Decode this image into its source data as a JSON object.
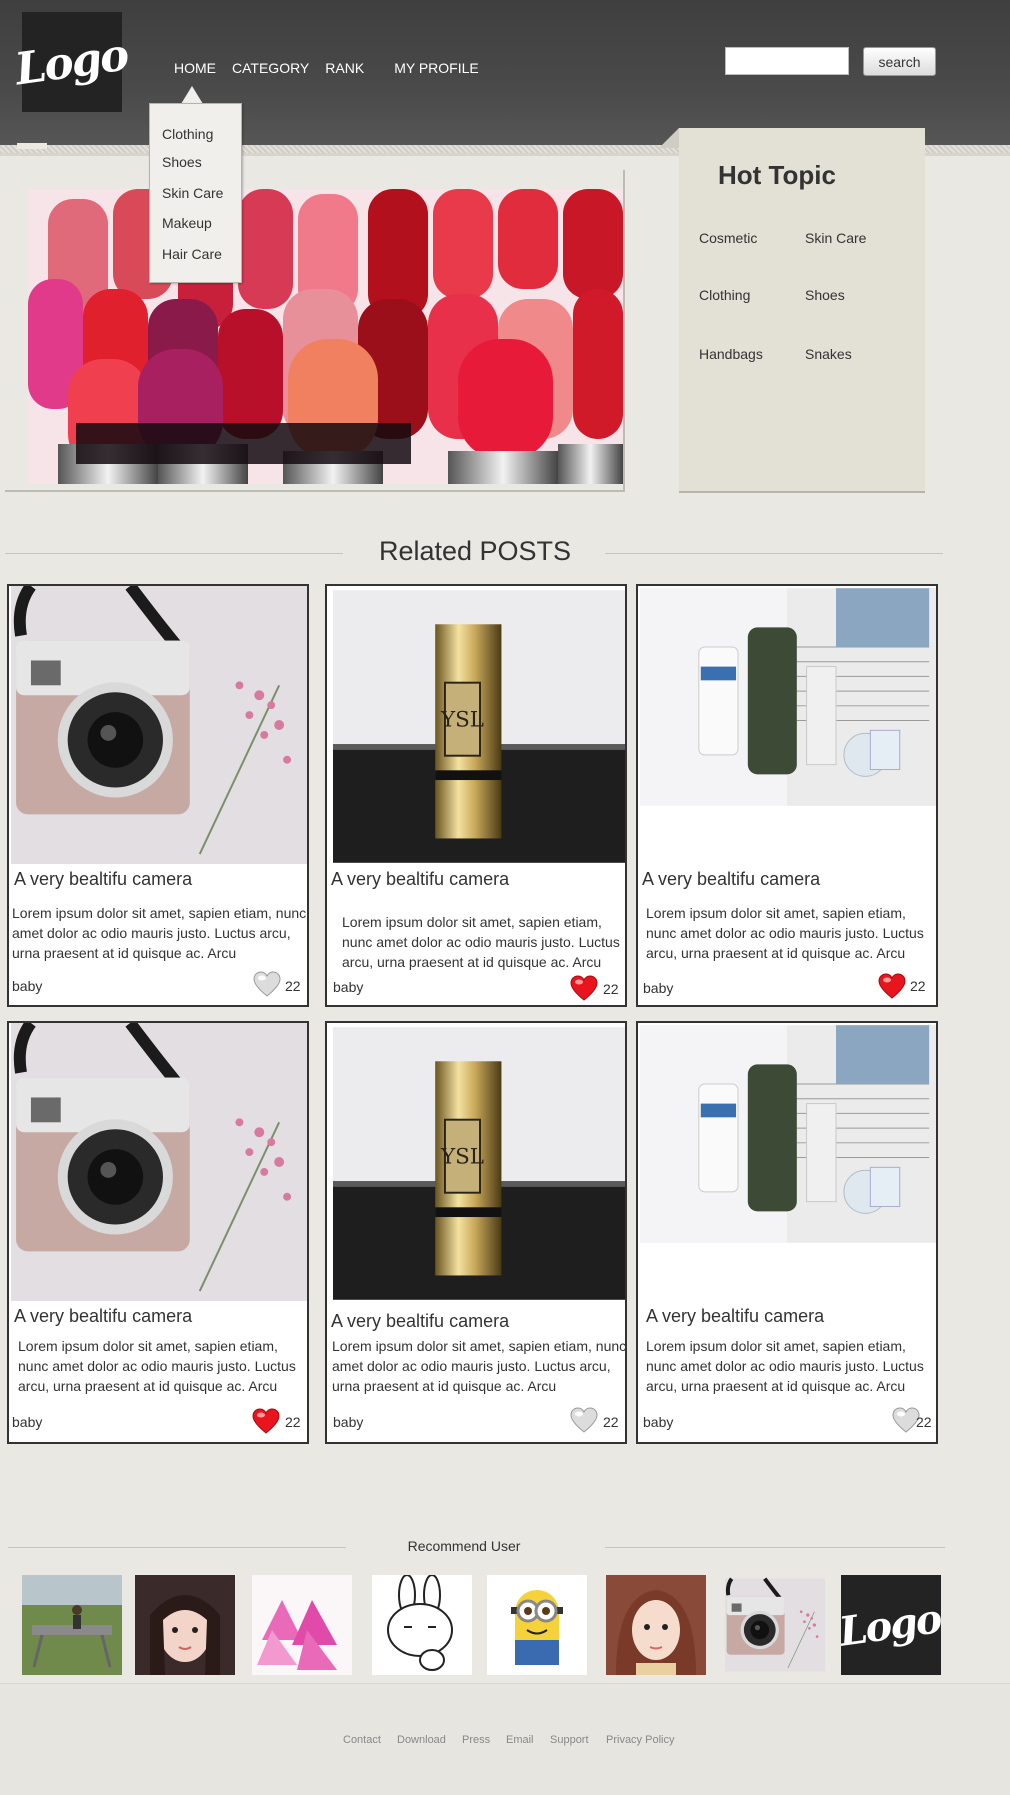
{
  "header": {
    "logo_text": "Logo",
    "nav": [
      "HOME",
      "CATEGORY",
      "RANK",
      "MY PROFILE"
    ],
    "search": {
      "value": "",
      "button_label": "search"
    }
  },
  "dropdown": {
    "items": [
      "Clothing",
      "Shoes",
      "Skin Care",
      "Makeup",
      "Hair Care"
    ]
  },
  "hot_topic": {
    "title": "Hot Topic",
    "items": [
      "Cosmetic",
      "Skin Care",
      "Clothing",
      "Shoes",
      "Handbags",
      "Snakes"
    ]
  },
  "related": {
    "title": "Related POSTS",
    "posts": [
      {
        "title": "A very bealtifu camera",
        "desc": "Lorem ipsum dolor sit amet, sapien etiam, nunc amet dolor ac odio mauris justo. Luctus arcu, urna praesent at id quisque ac. Arcu",
        "author": "baby",
        "likes": "22",
        "liked": false
      },
      {
        "title": "A very bealtifu camera",
        "desc": "Lorem ipsum dolor sit amet, sapien etiam, nunc amet dolor ac odio mauris justo. Luctus arcu, urna praesent at id quisque ac. Arcu",
        "author": "baby",
        "likes": "22",
        "liked": true
      },
      {
        "title": "A very bealtifu camera",
        "desc": "Lorem ipsum dolor sit amet, sapien etiam, nunc amet dolor ac odio mauris justo. Luctus arcu, urna praesent at id quisque ac. Arcu",
        "author": "baby",
        "likes": "22",
        "liked": true
      },
      {
        "title": "A very bealtifu camera",
        "desc": "Lorem ipsum dolor sit amet, sapien etiam, nunc amet dolor ac odio mauris justo. Luctus arcu, urna praesent at id quisque ac. Arcu",
        "author": "baby",
        "likes": "22",
        "liked": true
      },
      {
        "title": "A very bealtifu camera",
        "desc": "Lorem ipsum dolor sit amet, sapien etiam, nunc amet dolor ac odio mauris justo. Luctus arcu, urna praesent at id quisque ac. Arcu",
        "author": "baby",
        "likes": "22",
        "liked": false
      },
      {
        "title": "A very bealtifu camera",
        "desc": "Lorem ipsum dolor sit amet, sapien etiam, nunc amet dolor ac odio mauris justo. Luctus arcu, urna praesent at id quisque ac. Arcu",
        "author": "baby",
        "likes": "22",
        "liked": false
      }
    ]
  },
  "recommend": {
    "title": "Recommend User"
  },
  "footer": {
    "links": [
      "Contact",
      "Download",
      "Press",
      "Email",
      "Support",
      "Privacy Policy"
    ]
  },
  "colors": {
    "heart_liked": "#e8141e",
    "heart_unliked": "#d8d8d8",
    "accent_green": "#2ee37a"
  },
  "icons": [
    "heart-icon",
    "logo-mark"
  ]
}
